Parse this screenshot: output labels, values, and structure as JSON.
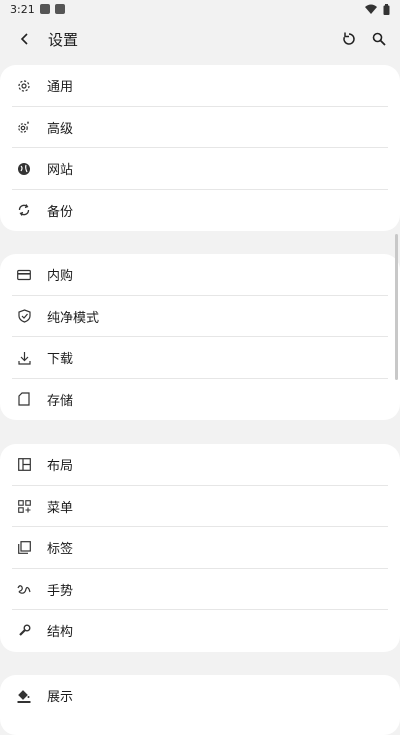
{
  "status": {
    "time": "3:21"
  },
  "appbar": {
    "title": "设置"
  },
  "groups": [
    {
      "items": [
        {
          "label": "通用",
          "icon": "gear-icon"
        },
        {
          "label": "高级",
          "icon": "advanced-gear-icon"
        },
        {
          "label": "网站",
          "icon": "globe-icon"
        },
        {
          "label": "备份",
          "icon": "sync-icon"
        }
      ]
    },
    {
      "items": [
        {
          "label": "内购",
          "icon": "credit-card-icon"
        },
        {
          "label": "纯净模式",
          "icon": "shield-icon"
        },
        {
          "label": "下载",
          "icon": "download-icon"
        },
        {
          "label": "存储",
          "icon": "sd-card-icon"
        }
      ]
    },
    {
      "items": [
        {
          "label": "布局",
          "icon": "layout-icon"
        },
        {
          "label": "菜单",
          "icon": "menu-grid-icon"
        },
        {
          "label": "标签",
          "icon": "tabs-icon"
        },
        {
          "label": "手势",
          "icon": "gesture-icon"
        },
        {
          "label": "结构",
          "icon": "wrench-icon"
        }
      ]
    },
    {
      "items": [
        {
          "label": "展示",
          "icon": "paint-bucket-icon"
        }
      ]
    }
  ]
}
